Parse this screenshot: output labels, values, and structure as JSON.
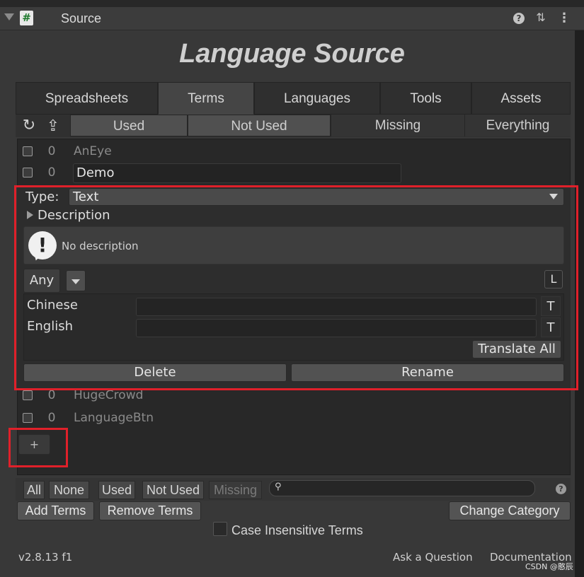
{
  "header": {
    "title": "Source",
    "script_glyph": "#",
    "help_glyph": "?",
    "presets_glyph": "⇅",
    "menu_glyph": "⋮"
  },
  "main_title": "Language Source",
  "tabs": [
    {
      "label": "Spreadsheets"
    },
    {
      "label": "Terms",
      "active": true
    },
    {
      "label": "Languages"
    },
    {
      "label": "Tools"
    },
    {
      "label": "Assets"
    }
  ],
  "filter": {
    "refresh_glyph": "↻",
    "export_glyph": "⇪",
    "tabs": [
      {
        "label": "Used",
        "on": true
      },
      {
        "label": "Not Used",
        "on": true
      },
      {
        "label": "Missing",
        "on": false
      },
      {
        "label": "Everything",
        "on": false
      }
    ]
  },
  "terms": [
    {
      "count": "0",
      "name": "AnEye"
    },
    {
      "count": "0",
      "name": "Demo"
    },
    {
      "count": "0",
      "name": "HugeCrowd"
    },
    {
      "count": "0",
      "name": "LanguageBtn"
    }
  ],
  "details": {
    "type_label": "Type:",
    "type_value": "Text",
    "description_label": "Description",
    "help_glyph": "!",
    "help_text": "No description",
    "specialization": "Any",
    "l_button": "L",
    "languages": [
      {
        "name": "Chinese",
        "value": "",
        "t_label": "T"
      },
      {
        "name": "English",
        "value": "",
        "t_label": "T"
      }
    ],
    "translate_all": "Translate All",
    "delete": "Delete",
    "rename": "Rename"
  },
  "add_button": "+",
  "toolbar": {
    "select_buttons": [
      "All",
      "None",
      "Used",
      "Not Used",
      "Missing"
    ],
    "search_glyph": "⚲",
    "search_value": "",
    "help_glyph": "?",
    "add_terms": "Add Terms",
    "remove_terms": "Remove Terms",
    "change_category": "Change Category",
    "case_insensitive": "Case Insensitive Terms"
  },
  "footer": {
    "version": "v2.8.13 f1",
    "ask": "Ask a Question",
    "docs": "Documentation",
    "watermark": "CSDN @憨辰"
  },
  "colors": {
    "highlight_red": "#e0202a",
    "background": "#383838"
  }
}
